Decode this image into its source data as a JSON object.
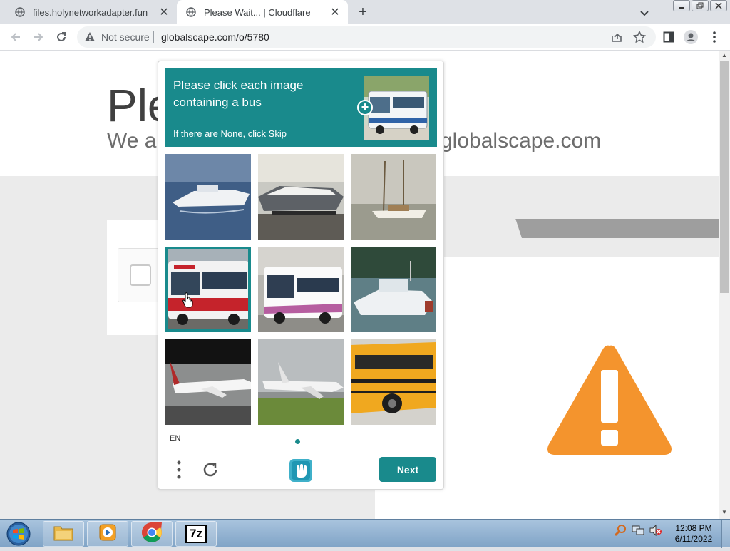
{
  "browser": {
    "tabs": [
      {
        "title": "files.holynetworkadapter.fun",
        "active": false
      },
      {
        "title": "Please Wait... | Cloudflare",
        "active": true
      }
    ],
    "new_tab": "+",
    "security_label": "Not secure",
    "url": "globalscape.com/o/5780"
  },
  "page": {
    "heading": "Ple",
    "sub_left": "We ar",
    "sub_right": "globalscape.com"
  },
  "captcha": {
    "prompt": "Please click each image containing a bus",
    "skip_hint": "If there are None, click Skip",
    "language": "EN",
    "next_label": "Next",
    "accent": "#198a8c",
    "tiles": [
      {
        "content": "white motor yacht on water",
        "selected": false
      },
      {
        "content": "speedboat on trailer",
        "selected": false
      },
      {
        "content": "sailboat on water",
        "selected": false
      },
      {
        "content": "red and white bus",
        "selected": true
      },
      {
        "content": "white city bus",
        "selected": false
      },
      {
        "content": "white fishing boat",
        "selected": false
      },
      {
        "content": "airliner on runway",
        "selected": false
      },
      {
        "content": "airliner landing",
        "selected": false
      },
      {
        "content": "yellow school bus",
        "selected": false
      }
    ]
  },
  "taskbar": {
    "time": "12:08 PM",
    "date": "6/11/2022",
    "apps": [
      "file-explorer",
      "media-player",
      "chrome",
      "7-zip"
    ],
    "sevenzip_label": "7z"
  }
}
